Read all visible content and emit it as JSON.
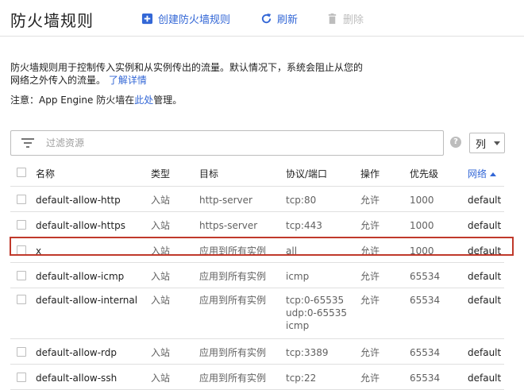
{
  "header": {
    "title": "防火墙规则",
    "create_label": "创建防火墙规则",
    "refresh_label": "刷新",
    "delete_label": "删除"
  },
  "description": {
    "text": "防火墙规则用于控制传入实例和从实例传出的流量。默认情况下，系统会阻止从您的网络之外传入的流量。",
    "learn_more": "了解详情"
  },
  "note": {
    "prefix": "注意：App Engine 防火墙在",
    "link": "此处",
    "suffix": "管理。"
  },
  "filter": {
    "placeholder": "过滤资源"
  },
  "columns_button": "列",
  "table": {
    "headers": {
      "name": "名称",
      "type": "类型",
      "target": "目标",
      "protocol": "协议/端口",
      "action": "操作",
      "priority": "优先级",
      "network": "网络"
    },
    "sorted_column": "network",
    "rows": [
      {
        "name": "default-allow-http",
        "type": "入站",
        "target": "http-server",
        "protocol": [
          "tcp:80"
        ],
        "action": "允许",
        "priority": "1000",
        "network": "default",
        "highlighted": false
      },
      {
        "name": "default-allow-https",
        "type": "入站",
        "target": "https-server",
        "protocol": [
          "tcp:443"
        ],
        "action": "允许",
        "priority": "1000",
        "network": "default",
        "highlighted": false
      },
      {
        "name": "x",
        "type": "入站",
        "target": "应用到所有实例",
        "protocol": [
          "all"
        ],
        "action": "允许",
        "priority": "1000",
        "network": "default",
        "highlighted": true
      },
      {
        "name": "default-allow-icmp",
        "type": "入站",
        "target": "应用到所有实例",
        "protocol": [
          "icmp"
        ],
        "action": "允许",
        "priority": "65534",
        "network": "default",
        "highlighted": false
      },
      {
        "name": "default-allow-internal",
        "type": "入站",
        "target": "应用到所有实例",
        "protocol": [
          "tcp:0-65535",
          "udp:0-65535",
          "icmp"
        ],
        "action": "允许",
        "priority": "65534",
        "network": "default",
        "highlighted": false
      },
      {
        "name": "default-allow-rdp",
        "type": "入站",
        "target": "应用到所有实例",
        "protocol": [
          "tcp:3389"
        ],
        "action": "允许",
        "priority": "65534",
        "network": "default",
        "highlighted": false
      },
      {
        "name": "default-allow-ssh",
        "type": "入站",
        "target": "应用到所有实例",
        "protocol": [
          "tcp:22"
        ],
        "action": "允许",
        "priority": "65534",
        "network": "default",
        "highlighted": false
      }
    ]
  },
  "colors": {
    "accent": "#3367d6",
    "highlight_border": "#c0392b",
    "disabled": "#bdbdbd"
  }
}
